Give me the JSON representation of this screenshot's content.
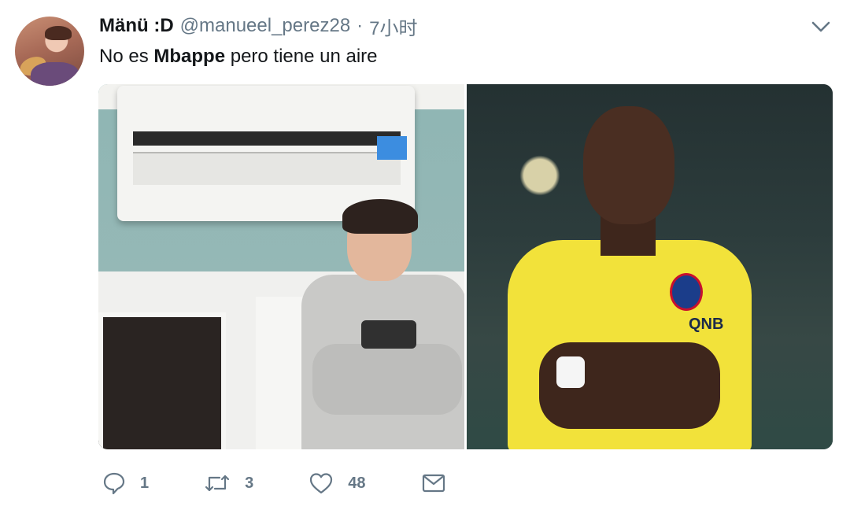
{
  "tweet": {
    "author": {
      "name": "Mänü :D",
      "handle": "@manueel_perez28",
      "separator": "·",
      "time": "7小时"
    },
    "text_parts": {
      "before": "No es ",
      "bold": "Mbappe",
      "after": " pero tiene un aire"
    },
    "media": {
      "images": [
        {
          "name": "person-under-air-conditioner"
        },
        {
          "name": "footballer-arms-crossed"
        }
      ],
      "sponsor_text": "QNB"
    },
    "actions": {
      "reply_count": "1",
      "retweet_count": "3",
      "like_count": "48"
    }
  },
  "colors": {
    "text_primary": "#14171a",
    "text_secondary": "#657786"
  },
  "icons": [
    "caret-down-icon",
    "reply-icon",
    "retweet-icon",
    "like-icon",
    "message-icon"
  ]
}
